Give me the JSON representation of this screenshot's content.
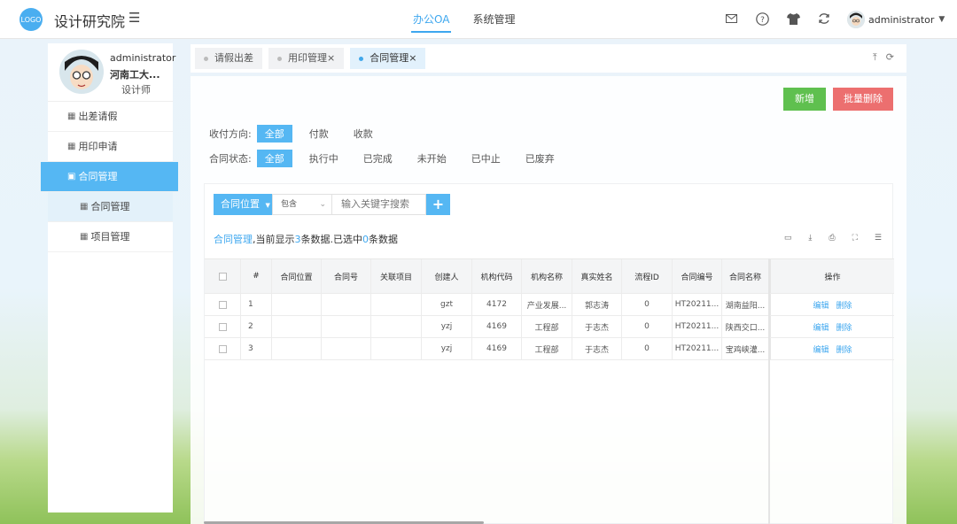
{
  "header": {
    "logo_text": "LOGO",
    "brand": "设计研究院",
    "nav": [
      {
        "label": "办公OA",
        "active": true
      },
      {
        "label": "系统管理",
        "active": false
      }
    ],
    "icons": [
      "mail-icon",
      "help-icon",
      "shirt-icon",
      "refresh-icon"
    ],
    "user": "administrator"
  },
  "sidebar": {
    "profile": {
      "name": "administrator",
      "org": "河南工大...",
      "role": "设计师"
    },
    "items": [
      {
        "label": "出差请假"
      },
      {
        "label": "用印申请"
      },
      {
        "label": "合同管理"
      },
      {
        "label": "合同管理"
      },
      {
        "label": "项目管理"
      }
    ]
  },
  "tabs": [
    {
      "label": "请假出差"
    },
    {
      "label": "用印管理×"
    },
    {
      "label": "合同管理×"
    }
  ],
  "toolbar": {
    "add_label": "新增",
    "batch_delete_label": "批量删除"
  },
  "filters": {
    "direction": {
      "label": "收付方向:",
      "options": [
        "全部",
        "付款",
        "收款"
      ]
    },
    "status": {
      "label": "合同状态:",
      "options": [
        "全部",
        "执行中",
        "已完成",
        "未开始",
        "已中止",
        "已废弃"
      ]
    }
  },
  "search": {
    "field": "合同位置",
    "operator": "包含",
    "placeholder": "输入关键字搜索",
    "add": "+"
  },
  "summary": {
    "prefix": "合同管理",
    "mid": ",当前显示",
    "count": "3",
    "mid2": "条数据.已选中",
    "selected": "0",
    "suffix": "条数据"
  },
  "table": {
    "columns": [
      "#",
      "合同位置",
      "合同号",
      "关联项目",
      "创建人",
      "机构代码",
      "机构名称",
      "真实姓名",
      "流程ID",
      "合同编号",
      "合同名称",
      "操作"
    ],
    "rows": [
      {
        "no": "1",
        "pos": "",
        "code": "",
        "proj": "",
        "creator": "gzt",
        "org_code": "4172",
        "org_name": "产业发展...",
        "real_name": "郭志涛",
        "flow_id": "0",
        "contract_no": "HT20211...",
        "contract_name": "湖南益阳...",
        "edit": "编辑",
        "del": "删除"
      },
      {
        "no": "2",
        "pos": "",
        "code": "",
        "proj": "",
        "creator": "yzj",
        "org_code": "4169",
        "org_name": "工程部",
        "real_name": "于志杰",
        "flow_id": "0",
        "contract_no": "HT20211...",
        "contract_name": "陕西交口...",
        "edit": "编辑",
        "del": "删除"
      },
      {
        "no": "3",
        "pos": "",
        "code": "",
        "proj": "",
        "creator": "yzj",
        "org_code": "4169",
        "org_name": "工程部",
        "real_name": "于志杰",
        "flow_id": "0",
        "contract_no": "HT20211...",
        "contract_name": "宝鸡峡灌...",
        "edit": "编辑",
        "del": "删除"
      }
    ]
  },
  "colors": {
    "accent": "#55b7f3",
    "add": "#5fc04f",
    "danger": "#ec6f6f"
  }
}
